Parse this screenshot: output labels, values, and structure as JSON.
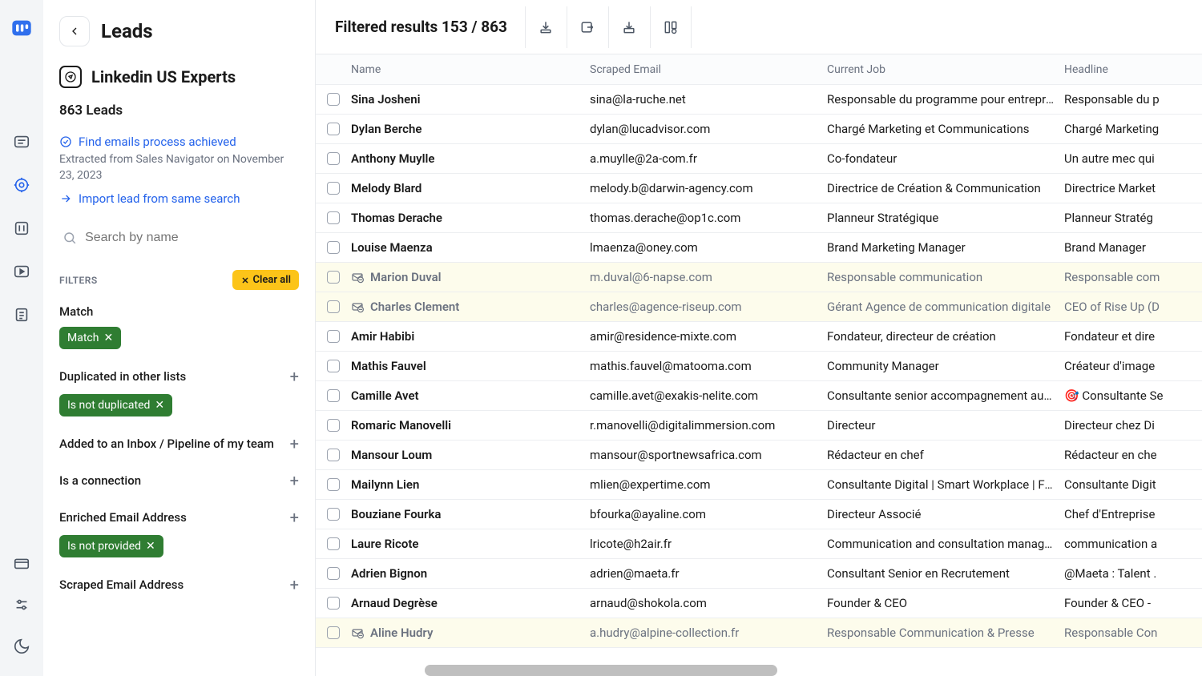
{
  "sidebar": {
    "title": "Leads",
    "list_name": "Linkedin US Experts",
    "leads_count": "863 Leads",
    "status_line": "Find emails process achieved",
    "sub_note": "Extracted from Sales Navigator on November 23, 2023",
    "import_label": "Import lead from same search",
    "search_placeholder": "Search by name",
    "filters_label": "FILTERS",
    "clear_all": "Clear all",
    "filters": {
      "match": {
        "label": "Match",
        "chip": "Match"
      },
      "dup": {
        "label": "Duplicated in other lists",
        "chip": "Is not duplicated"
      },
      "inbox": {
        "label": "Added to an Inbox / Pipeline of my team"
      },
      "connection": {
        "label": "Is a connection"
      },
      "enriched": {
        "label": "Enriched Email Address",
        "chip": "Is not provided"
      },
      "scraped": {
        "label": "Scraped Email Address"
      }
    }
  },
  "topbar": {
    "title": "Filtered results 153 / 863"
  },
  "table": {
    "headers": {
      "name": "Name",
      "email": "Scraped Email",
      "job": "Current Job",
      "headline": "Headline"
    },
    "rows": [
      {
        "name": "Sina Josheni",
        "email": "sina@la-ruche.net",
        "job": "Responsable du programme pour entrepre...",
        "headline": "Responsable du p",
        "hl": false,
        "flag": false
      },
      {
        "name": "Dylan Berche",
        "email": "dylan@lucadvisor.com",
        "job": "Chargé Marketing et Communications",
        "headline": "Chargé Marketing",
        "hl": false,
        "flag": false
      },
      {
        "name": "Anthony Muylle",
        "email": "a.muylle@2a-com.fr",
        "job": "Co-fondateur",
        "headline": "Un autre mec qui",
        "hl": false,
        "flag": false
      },
      {
        "name": "Melody Blard",
        "email": "melody.b@darwin-agency.com",
        "job": "Directrice de Création & Communication",
        "headline": "Directrice Market",
        "hl": false,
        "flag": false
      },
      {
        "name": "Thomas Derache",
        "email": "thomas.derache@op1c.com",
        "job": "Planneur Stratégique",
        "headline": "Planneur Stratég",
        "hl": false,
        "flag": false
      },
      {
        "name": "Louise Maenza",
        "email": "lmaenza@oney.com",
        "job": "Brand Marketing Manager",
        "headline": "Brand Manager",
        "hl": false,
        "flag": false
      },
      {
        "name": "Marion Duval",
        "email": "m.duval@6-napse.com",
        "job": "Responsable communication",
        "headline": "Responsable com",
        "hl": true,
        "flag": true
      },
      {
        "name": "Charles Clement",
        "email": "charles@agence-riseup.com",
        "job": "Gérant Agence de communication digitale",
        "headline": "CEO of Rise Up (D",
        "hl": true,
        "flag": true
      },
      {
        "name": "Amir Habibi",
        "email": "amir@residence-mixte.com",
        "job": "Fondateur, directeur de création",
        "headline": "Fondateur et dire",
        "hl": false,
        "flag": false
      },
      {
        "name": "Mathis Fauvel",
        "email": "mathis.fauvel@matooma.com",
        "job": "Community Manager",
        "headline": "Créateur d'image",
        "hl": false,
        "flag": false
      },
      {
        "name": "Camille Avet",
        "email": "camille.avet@exakis-nelite.com",
        "job": "Consultante senior accompagnement au c...",
        "headline": "🎯 Consultante Se",
        "hl": false,
        "flag": false
      },
      {
        "name": "Romaric Manovelli",
        "email": "r.manovelli@digitalimmersion.com",
        "job": "Directeur",
        "headline": "Directeur chez Di",
        "hl": false,
        "flag": false
      },
      {
        "name": "Mansour Loum",
        "email": "mansour@sportnewsafrica.com",
        "job": "Rédacteur en chef",
        "headline": "Rédacteur en che",
        "hl": false,
        "flag": false
      },
      {
        "name": "Mailynn Lien",
        "email": "mlien@expertime.com",
        "job": "Consultante Digital | Smart Workplace | Fo...",
        "headline": "Consultante Digit",
        "hl": false,
        "flag": false
      },
      {
        "name": "Bouziane Fourka",
        "email": "bfourka@ayaline.com",
        "job": "Directeur Associé",
        "headline": "Chef d'Entreprise",
        "hl": false,
        "flag": false
      },
      {
        "name": "Laure Ricote",
        "email": "lricote@h2air.fr",
        "job": "Communication and consultation manager",
        "headline": "communication a",
        "hl": false,
        "flag": false
      },
      {
        "name": "Adrien Bignon",
        "email": "adrien@maeta.fr",
        "job": "Consultant Senior en Recrutement",
        "headline": "@Maeta : Talent .",
        "hl": false,
        "flag": false
      },
      {
        "name": "Arnaud Degrèse",
        "email": "arnaud@shokola.com",
        "job": "Founder & CEO",
        "headline": "Founder & CEO -",
        "hl": false,
        "flag": false
      },
      {
        "name": "Aline Hudry",
        "email": "a.hudry@alpine-collection.fr",
        "job": "Responsable Communication & Presse",
        "headline": "Responsable Con",
        "hl": true,
        "flag": true
      }
    ]
  }
}
